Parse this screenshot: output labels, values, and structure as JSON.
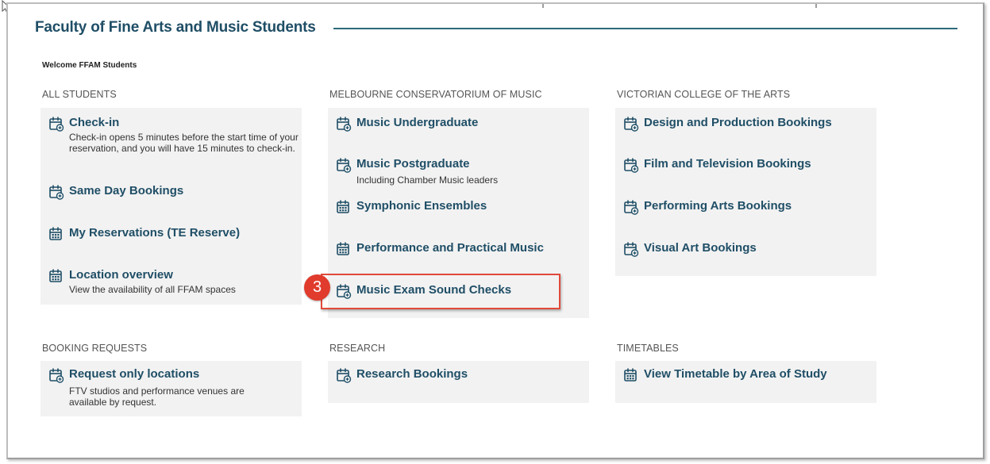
{
  "page_title": "Faculty of Fine Arts and Music Students",
  "welcome": "Welcome FFAM Students",
  "sections": {
    "all_students": {
      "heading": "ALL STUDENTS",
      "items": [
        {
          "label": "Check-in",
          "icon": "calendar-plus-icon",
          "desc": "Check-in opens 5 minutes before the start time of your reservation, and you will have 15 minutes to check-in."
        },
        {
          "label": "Same Day Bookings",
          "icon": "calendar-plus-icon"
        },
        {
          "label": "My Reservations (TE Reserve)",
          "icon": "calendar-grid-icon"
        },
        {
          "label": "Location overview",
          "icon": "calendar-grid-icon",
          "desc": "View the availability of all FFAM spaces"
        }
      ]
    },
    "conservatorium": {
      "heading": "MELBOURNE CONSERVATORIUM OF MUSIC",
      "items": [
        {
          "label": "Music Undergraduate",
          "icon": "calendar-plus-icon"
        },
        {
          "label": "Music Postgraduate",
          "icon": "calendar-plus-icon",
          "desc": "Including Chamber Music leaders"
        },
        {
          "label": "Symphonic Ensembles",
          "icon": "calendar-grid-icon"
        },
        {
          "label": "Performance and Practical Music",
          "icon": "calendar-grid-icon"
        },
        {
          "label": "Music Exam Sound Checks",
          "icon": "calendar-plus-icon"
        }
      ]
    },
    "vca": {
      "heading": "VICTORIAN COLLEGE OF THE ARTS",
      "items": [
        {
          "label": "Design and Production Bookings",
          "icon": "calendar-plus-icon"
        },
        {
          "label": "Film and Television Bookings",
          "icon": "calendar-plus-icon"
        },
        {
          "label": "Performing Arts Bookings",
          "icon": "calendar-plus-icon"
        },
        {
          "label": "Visual Art Bookings",
          "icon": "calendar-plus-icon"
        }
      ]
    },
    "booking_requests": {
      "heading": "BOOKING REQUESTS",
      "items": [
        {
          "label": "Request only locations",
          "icon": "calendar-plus-icon",
          "desc": "FTV studios and performance venues are available by request."
        }
      ]
    },
    "research": {
      "heading": "RESEARCH",
      "items": [
        {
          "label": "Research Bookings",
          "icon": "calendar-plus-icon"
        }
      ]
    },
    "timetables": {
      "heading": "TIMETABLES",
      "items": [
        {
          "label": "View Timetable by Area of Study",
          "icon": "calendar-grid-icon"
        }
      ]
    }
  },
  "annotation": {
    "step": "3",
    "color": "#e03b2c"
  },
  "colors": {
    "link": "#1f4e66",
    "card_bg": "#f2f2f2",
    "rule": "#2d6a7a",
    "highlight": "#e04a3a"
  }
}
